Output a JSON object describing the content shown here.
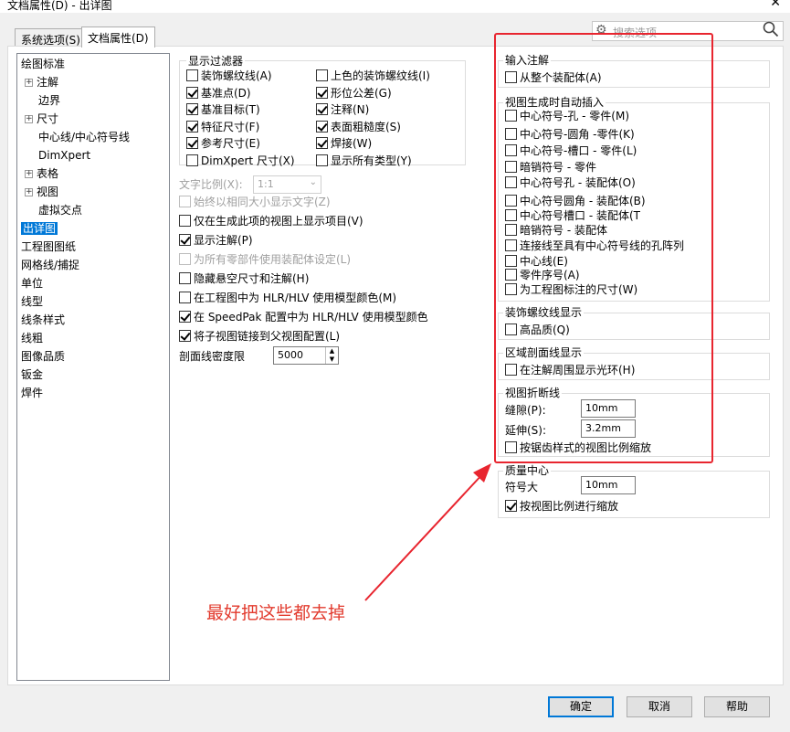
{
  "window": {
    "title": "文档属性(D) - 出详图",
    "close": "✕"
  },
  "tabs": [
    {
      "label": "系统选项(S)"
    },
    {
      "label": "文档属性(D)"
    }
  ],
  "search": {
    "placeholder": "搜索选项"
  },
  "tree": {
    "items": [
      {
        "label": "绘图标准",
        "expander": ""
      },
      {
        "label": "注解",
        "expander": "+"
      },
      {
        "label": "边界",
        "expander": ""
      },
      {
        "label": "尺寸",
        "expander": "+"
      },
      {
        "label": "中心线/中心符号线",
        "expander": ""
      },
      {
        "label": "DimXpert",
        "expander": ""
      },
      {
        "label": "表格",
        "expander": "+"
      },
      {
        "label": "视图",
        "expander": "+"
      },
      {
        "label": "虚拟交点",
        "expander": ""
      },
      {
        "label": "出详图",
        "expander": "",
        "selected": true
      },
      {
        "label": "工程图图纸",
        "expander": ""
      },
      {
        "label": "网格线/捕捉",
        "expander": ""
      },
      {
        "label": "单位",
        "expander": ""
      },
      {
        "label": "线型",
        "expander": ""
      },
      {
        "label": "线条样式",
        "expander": ""
      },
      {
        "label": "线粗",
        "expander": ""
      },
      {
        "label": "图像品质",
        "expander": ""
      },
      {
        "label": "钣金",
        "expander": ""
      },
      {
        "label": "焊件",
        "expander": ""
      }
    ]
  },
  "display_filter": {
    "title": "显示过滤器",
    "left": [
      {
        "label": "装饰螺纹线(A)",
        "checked": false
      },
      {
        "label": "基准点(D)",
        "checked": true
      },
      {
        "label": "基准目标(T)",
        "checked": true
      },
      {
        "label": "特征尺寸(F)",
        "checked": true
      },
      {
        "label": "参考尺寸(E)",
        "checked": true
      },
      {
        "label": "DimXpert 尺寸(X)",
        "checked": false
      }
    ],
    "right": [
      {
        "label": "上色的装饰螺纹线(I)",
        "checked": false
      },
      {
        "label": "形位公差(G)",
        "checked": true
      },
      {
        "label": "注释(N)",
        "checked": true
      },
      {
        "label": "表面粗糙度(S)",
        "checked": true
      },
      {
        "label": "焊接(W)",
        "checked": true
      },
      {
        "label": "显示所有类型(Y)",
        "checked": false
      }
    ]
  },
  "text_scale": {
    "label": "文字比例(X):",
    "value": "1:1"
  },
  "mid_options": [
    {
      "label": "始终以相同大小显示文字(Z)",
      "checked": false,
      "disabled": true
    },
    {
      "label": "仅在生成此项的视图上显示项目(V)",
      "checked": false
    },
    {
      "label": "显示注解(P)",
      "checked": true
    },
    {
      "label": "为所有零部件使用装配体设定(L)",
      "checked": false,
      "disabled": true
    },
    {
      "label": "隐藏悬空尺寸和注解(H)",
      "checked": false
    },
    {
      "label": "在工程图中为 HLR/HLV 使用模型颜色(M)",
      "checked": false
    },
    {
      "label": "在 SpeedPak 配置中为 HLR/HLV 使用模型颜色",
      "checked": true
    },
    {
      "label": "将子视图链接到父视图配置(L)",
      "checked": true
    }
  ],
  "hatch_density": {
    "label": "剖面线密度限",
    "value": "5000"
  },
  "import_annotations": {
    "title": "输入注解",
    "items": [
      {
        "label": "从整个装配体(A)",
        "checked": false
      }
    ]
  },
  "auto_insert": {
    "title": "视图生成时自动插入",
    "items": [
      {
        "label": "中心符号-孔 - 零件(M)",
        "checked": false
      },
      {
        "label": "中心符号-圆角 -零件(K)",
        "checked": false
      },
      {
        "label": "中心符号-槽口 - 零件(L)",
        "checked": false
      },
      {
        "label": "暗销符号 - 零件",
        "checked": false
      },
      {
        "label": "中心符号孔 - 装配体(O)",
        "checked": false
      },
      {
        "label": "中心符号圆角 - 装配体(B)",
        "checked": false
      },
      {
        "label": "中心符号槽口 - 装配体(T",
        "checked": false
      },
      {
        "label": "暗销符号 - 装配体",
        "checked": false
      },
      {
        "label": "连接线至具有中心符号线的孔阵列",
        "checked": false
      },
      {
        "label": "中心线(E)",
        "checked": false
      },
      {
        "label": "零件序号(A)",
        "checked": false
      },
      {
        "label": "为工程图标注的尺寸(W)",
        "checked": false
      }
    ]
  },
  "cosmetic_thread": {
    "title": "装饰螺纹线显示",
    "items": [
      {
        "label": "高品质(Q)",
        "checked": false
      }
    ]
  },
  "area_hatch": {
    "title": "区域剖面线显示",
    "items": [
      {
        "label": "在注解周围显示光环(H)",
        "checked": false
      }
    ]
  },
  "view_break": {
    "title": "视图折断线",
    "gap_label": "缝隙(P):",
    "gap_value": "10mm",
    "extension_label": "延伸(S):",
    "extension_value": "3.2mm",
    "scale_label": "按锯齿样式的视图比例缩放",
    "scale_checked": false
  },
  "center_of_mass": {
    "title": "质量中心",
    "size_label": "符号大",
    "size_value": "10mm",
    "scale_label": "按视图比例进行缩放",
    "scale_checked": true
  },
  "annotation": {
    "text": "最好把这些都去掉",
    "color": "#e23b2e"
  },
  "buttons": {
    "ok": "确定",
    "cancel": "取消",
    "help": "帮助"
  },
  "colors": {
    "accent": "#0078d7",
    "highlight": "#e8252f"
  }
}
